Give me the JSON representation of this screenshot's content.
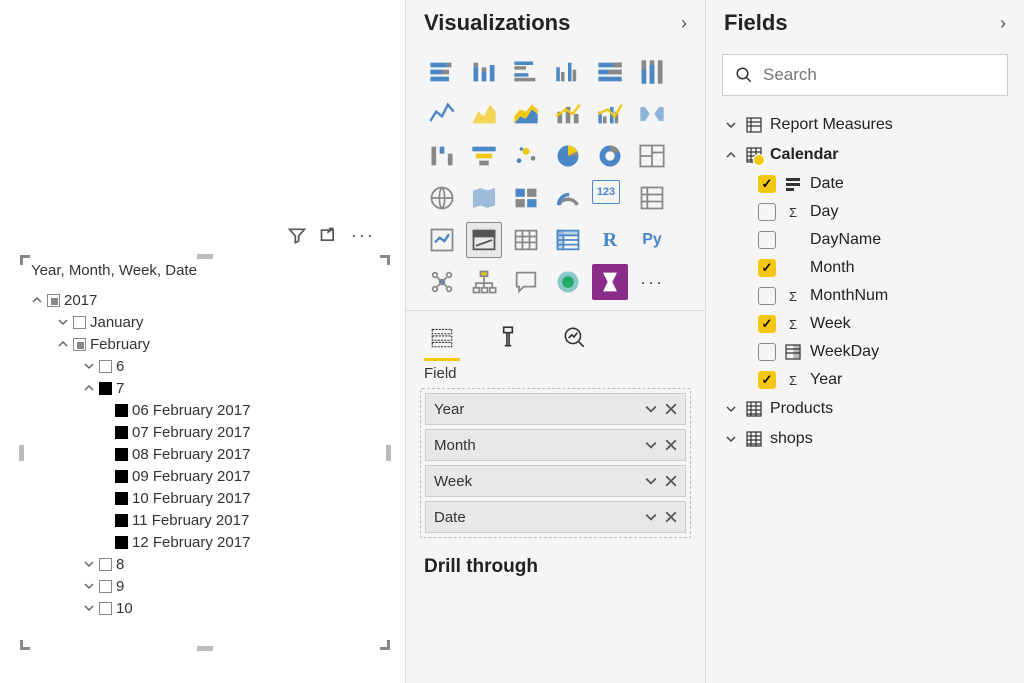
{
  "slicer": {
    "header": "Year, Month, Week, Date",
    "year": "2017",
    "months": {
      "jan": "January",
      "feb": "February"
    },
    "weeks": {
      "w6": "6",
      "w7": "7",
      "w8": "8",
      "w9": "9",
      "w10": "10"
    },
    "dates": [
      "06 February 2017",
      "07 February 2017",
      "08 February 2017",
      "09 February 2017",
      "10 February 2017",
      "11 February 2017",
      "12 February 2017"
    ]
  },
  "viz_pane": {
    "title": "Visualizations",
    "field_section": "Field",
    "wells": [
      "Year",
      "Month",
      "Week",
      "Date"
    ],
    "drill_section": "Drill through"
  },
  "fields_pane": {
    "title": "Fields",
    "search_placeholder": "Search",
    "tables": {
      "report_measures": "Report Measures",
      "calendar": "Calendar",
      "products": "Products",
      "shops": "shops"
    },
    "calendar_fields": {
      "date": "Date",
      "day": "Day",
      "dayname": "DayName",
      "month": "Month",
      "monthnum": "MonthNum",
      "week": "Week",
      "weekday": "WeekDay",
      "year": "Year"
    }
  }
}
